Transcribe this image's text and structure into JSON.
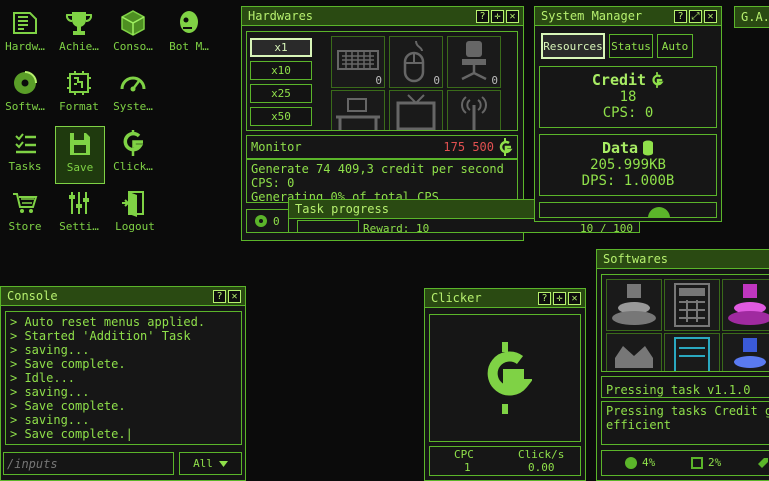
{
  "desktop_icons": [
    {
      "label": "Hardw…",
      "icon": "chip-icon"
    },
    {
      "label": "Achie…",
      "icon": "trophy-icon"
    },
    {
      "label": "Conso…",
      "icon": "cube-icon"
    },
    {
      "label": "Bot M…",
      "icon": "robot-head-icon"
    },
    {
      "label": "Softw…",
      "icon": "disc-icon"
    },
    {
      "label": "Format",
      "icon": "circuit-icon"
    },
    {
      "label": "Syste…",
      "icon": "gauge-icon"
    },
    {
      "label": "Tasks",
      "icon": "list-icon"
    },
    {
      "label": "Save",
      "icon": "floppy-icon"
    },
    {
      "label": "Click…",
      "icon": "credit-icon"
    },
    {
      "label": "Store",
      "icon": "cart-icon"
    },
    {
      "label": "Setti…",
      "icon": "sliders-icon"
    },
    {
      "label": "Logout",
      "icon": "door-icon"
    }
  ],
  "hardwares": {
    "title": "Hardwares",
    "multipliers": [
      "x1",
      "x10",
      "x25",
      "x50"
    ],
    "items": [
      {
        "icon": "keyboard-icon",
        "count": "0"
      },
      {
        "icon": "mouse-icon",
        "count": "0"
      },
      {
        "icon": "chair-icon",
        "count": "0"
      },
      {
        "icon": "desk-icon",
        "count": ""
      },
      {
        "icon": "tv-icon",
        "count": ""
      },
      {
        "icon": "antenna-icon",
        "count": ""
      }
    ],
    "monitor_label": "Monitor",
    "monitor_cost": "175 500",
    "desc_line1": "Generate 74 409,3 credit per second",
    "desc_line2": "CPS: 0",
    "desc_line3": "Generating 0% of total CPS",
    "footer_value": "0"
  },
  "task_progress": {
    "title": "Task progress",
    "reward_label": "Reward: 10",
    "progress": "10 / 100"
  },
  "system_manager": {
    "title": "System Manager",
    "tabs": [
      "Resources",
      "Status",
      "Auto"
    ],
    "credit_label": "Credit",
    "credit_value": "18",
    "cps_label": "CPS: 0",
    "data_label": "Data",
    "data_value": "205.999KB",
    "dps_label": "DPS: 1.000B"
  },
  "ga_title": "G.A.",
  "console": {
    "title": "Console",
    "lines": [
      "> Auto reset menus applied.",
      "> Started 'Addition' Task",
      "> saving...",
      "> Save complete.",
      "> Idle...",
      "> saving...",
      "> Save complete.",
      "> saving...",
      "> Save complete.|"
    ],
    "input_placeholder": "/inputs",
    "filter": "All"
  },
  "clicker": {
    "title": "Clicker",
    "cpc_label": "CPC",
    "cpc_value": "1",
    "clicks_label": "Click/s",
    "clicks_value": "0.00"
  },
  "softwares": {
    "title": "Softwares",
    "item_name": "Pressing task v1.1.0",
    "item_desc1": "Pressing tasks Credit ga",
    "item_desc2": "efficient",
    "stat1": "4%",
    "stat2": "2%"
  },
  "colors": {
    "accent": "#8fe04a",
    "title_bg": "#2a4a12",
    "cost_red": "#e05050"
  }
}
